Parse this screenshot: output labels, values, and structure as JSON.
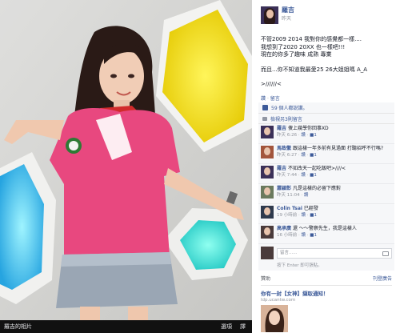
{
  "photo": {
    "caption": "羅吉的相片",
    "options_label": "選項",
    "edit_label": "譯"
  },
  "post": {
    "author": "羅吉",
    "time": "昨天",
    "lines": [
      "不管2009 2014 我對你的感覺都一樣....",
      "我想到了2020 20XX 也一樣吧!!!",
      "現在的你多了趣味 成熟 專業"
    ],
    "lines2": [
      "而且...你不知道我最愛25 26大姐姐嗎 A_A"
    ],
    "lines3": [
      ">//////<"
    ],
    "like_action": "讚",
    "comment_action": "留言"
  },
  "likes": {
    "text": "59 個人都說讚。"
  },
  "more_comments": {
    "text": "檢視另3則留言"
  },
  "comments": [
    {
      "name": "羅吉",
      "text": "傻上幾學你回事XD",
      "time": "昨天 6:26",
      "likes": "1",
      "avatar_color": "#3b3058"
    },
    {
      "name": "馬致徽",
      "text": "跟這樣一年多前有見過面 打聽招呼不行嗎?",
      "time": "昨天 6:27",
      "likes": "1",
      "avatar_color": "#a2553c"
    },
    {
      "name": "羅吉",
      "text": "不如改天一起吃飯吧>////<",
      "time": "昨天 7:44",
      "likes": "1",
      "avatar_color": "#3b3058"
    },
    {
      "name": "蕭穎彰",
      "text": "凡是這樣的必留下應對",
      "time": "昨天 11:04",
      "likes": "",
      "avatar_color": "#6b7a5e"
    },
    {
      "name": "Colin Tsai",
      "text": "已經發",
      "time": "19 小時前",
      "likes": "1",
      "avatar_color": "#2f3a4d"
    },
    {
      "name": "高承廣",
      "text": "還 ～～警察先生，我是這樣人",
      "time": "16 小時前",
      "likes": "1",
      "avatar_color": "#4a3b3b"
    }
  ],
  "comment_action": "讚",
  "compose": {
    "placeholder": "留言......",
    "hint": "按下 Enter 即可張貼。"
  },
  "sponsor": {
    "label": "贊助",
    "create_ad": "刊登廣告",
    "ad_title": "你有一封【女神】擷取通知！",
    "ad_url": "ldp.ucantw.com"
  }
}
